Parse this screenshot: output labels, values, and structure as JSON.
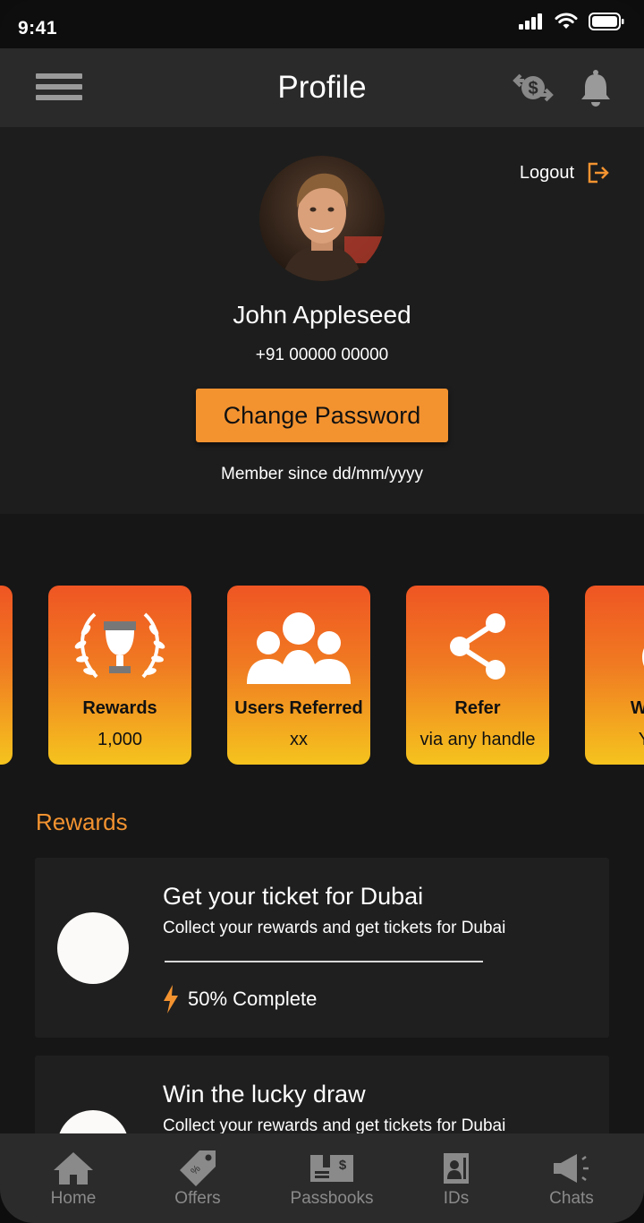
{
  "status_bar": {
    "time": "9:41"
  },
  "header": {
    "title": "Profile"
  },
  "profile": {
    "logout_label": "Logout",
    "name": "John Appleseed",
    "phone": "+91 00000 00000",
    "change_password_label": "Change Password",
    "member_since": "Member since dd/mm/yyyy"
  },
  "stat_cards": [
    {
      "title": "Rewards",
      "value": "1,000",
      "icon": "trophy-icon"
    },
    {
      "title": "Users Referred",
      "value": "xx",
      "icon": "users-icon"
    },
    {
      "title": "Refer",
      "value": "via any handle",
      "icon": "share-icon"
    },
    {
      "title": "Wallet",
      "value": "Your",
      "icon": "money-bag-icon"
    }
  ],
  "rewards": {
    "heading": "Rewards",
    "items": [
      {
        "title": "Get your ticket for Dubai",
        "description": "Collect your rewards and get tickets for Dubai",
        "progress_label": "50% Complete",
        "progress": 0.5
      },
      {
        "title": "Win the lucky draw",
        "description": "Collect your rewards and get tickets for Dubai"
      }
    ]
  },
  "bottom_nav": [
    {
      "label": "Home",
      "icon": "home-icon"
    },
    {
      "label": "Offers",
      "icon": "tag-icon"
    },
    {
      "label": "Passbooks",
      "icon": "passbook-icon"
    },
    {
      "label": "IDs",
      "icon": "id-card-icon"
    },
    {
      "label": "Chats",
      "icon": "megaphone-icon"
    }
  ],
  "colors": {
    "accent": "#F39330",
    "card_gradient_top": "#EF5523",
    "card_gradient_bottom": "#F5C41E",
    "background": "#161616"
  }
}
